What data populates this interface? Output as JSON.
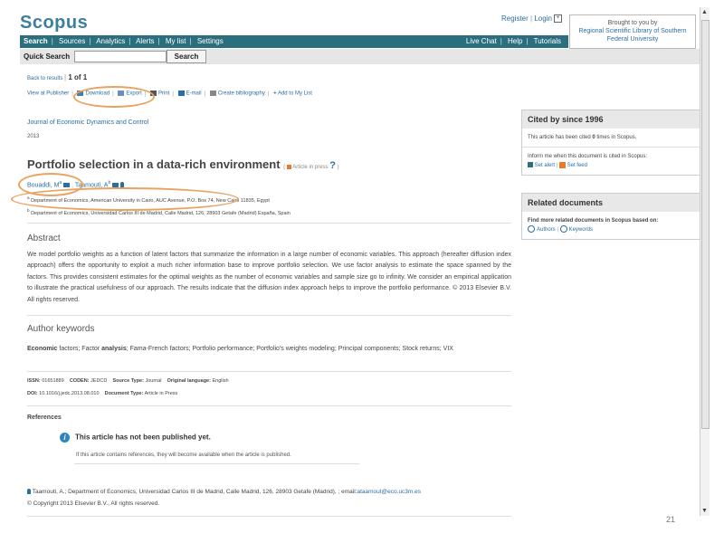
{
  "header": {
    "logo": "Scopus",
    "register": "Register",
    "login": "Login",
    "brought_line1": "Brought to you by",
    "brought_line2": "Regional Scientific Library of Southern",
    "brought_line3": "Federal University"
  },
  "nav": {
    "left": [
      "Search",
      "Sources",
      "Analytics",
      "Alerts",
      "My list",
      "Settings"
    ],
    "right": [
      "Live Chat",
      "Help",
      "Tutorials"
    ]
  },
  "quick_search": {
    "label": "Quick Search",
    "value": "",
    "button": "Search"
  },
  "results": {
    "back": "Back to results",
    "count": "1 of 1"
  },
  "toolbar": {
    "publisher": "View at Publisher",
    "download": "Download",
    "export": "Export",
    "print": "Print",
    "email": "E-mail",
    "bibliography": "Create bibliography",
    "mylist": "Add to My List"
  },
  "document": {
    "journal": "Journal of Economic Dynamics and Control",
    "year": "2013",
    "title": "Portfolio selection in a data-rich environment",
    "press": "Article in press",
    "author1": "Bouaddi, M",
    "author1_sup": "a",
    "author2": "Taamouti, A",
    "author2_sup": "b",
    "aff1": "Department of Economics, American University in Cairo, AUC Avenue, P.O. Box 74, New Cairo 11835, Egypt",
    "aff1_sup": "a",
    "aff2": "Department of Economics, Universidad Carlos III de Madrid, Calle Madrid, 126, 28903 Getafe (Madrid) España, Spain",
    "aff2_sup": "b"
  },
  "abstract": {
    "heading": "Abstract",
    "text": "We model portfolio weights as a function of latent factors that summarize the information in a large number of economic variables. This approach (hereafter diffusion index approach) offers the opportunity to exploit a much richer information base to improve portfolio selection. We use factor analysis to estimate the space spanned by the factors. This provides consistent estimates for the optimal weights as the number of economic variables and sample size go to infinity. We consider an empirical application to illustrate the practical usefulness of our approach. The results indicate that the diffusion index approach helps to improve the portfolio performance. © 2013 Elsevier B.V. All rights reserved."
  },
  "keywords": {
    "heading": "Author keywords",
    "kw_economic": "Economic",
    "kw_factors1": " factors; Factor ",
    "kw_analysis": "analysis",
    "kw_rest": "; Fama-French factors; Portfolio performance; Portfolio's weights modeling; Principal components; Stock returns; VIX"
  },
  "meta": {
    "issn_label": "ISSN:",
    "issn": "01651889",
    "coden_label": "CODEN:",
    "coden": "JEDCD",
    "source_label": "Source Type:",
    "source": "Journal",
    "lang_label": "Original language:",
    "lang": "English",
    "doi_label": "DOI:",
    "doi": "10.1016/j.jedc.2013.08.010",
    "doctype_label": "Document Type:",
    "doctype": "Article in Press"
  },
  "references": {
    "heading": "References",
    "notice": "This article has not been published yet.",
    "subnotice": "If this article contains references, they will become available when the article is published."
  },
  "footer": {
    "correspondence": "Taamouti, A.; Department of Economics, Universidad Carlos III de Madrid, Calle Madrid, 126, 28903 Getafe (Madrid), ; email:",
    "email": "ataamout@eco.uc3m.es",
    "copyright": "© Copyright 2013 Elsevier B.V., All rights reserved."
  },
  "cited": {
    "heading": "Cited by since 1996",
    "text_pre": "This article has been cited ",
    "count": "0",
    "text_post": " times in Scopus.",
    "inform": "Inform me when this document is cited in Scopus:",
    "set_alert": "Set alert",
    "set_feed": "Set feed"
  },
  "related": {
    "heading": "Related documents",
    "find": "Find more related documents in Scopus based on:",
    "authors": "Authors",
    "keywords": "Keywords"
  },
  "slide": {
    "page_number": "21"
  },
  "colors": {
    "nav_bg": "#2b6f7f",
    "link": "#2a6ea5",
    "logo": "#3d7fa0",
    "annotation": "#e9a25f"
  }
}
